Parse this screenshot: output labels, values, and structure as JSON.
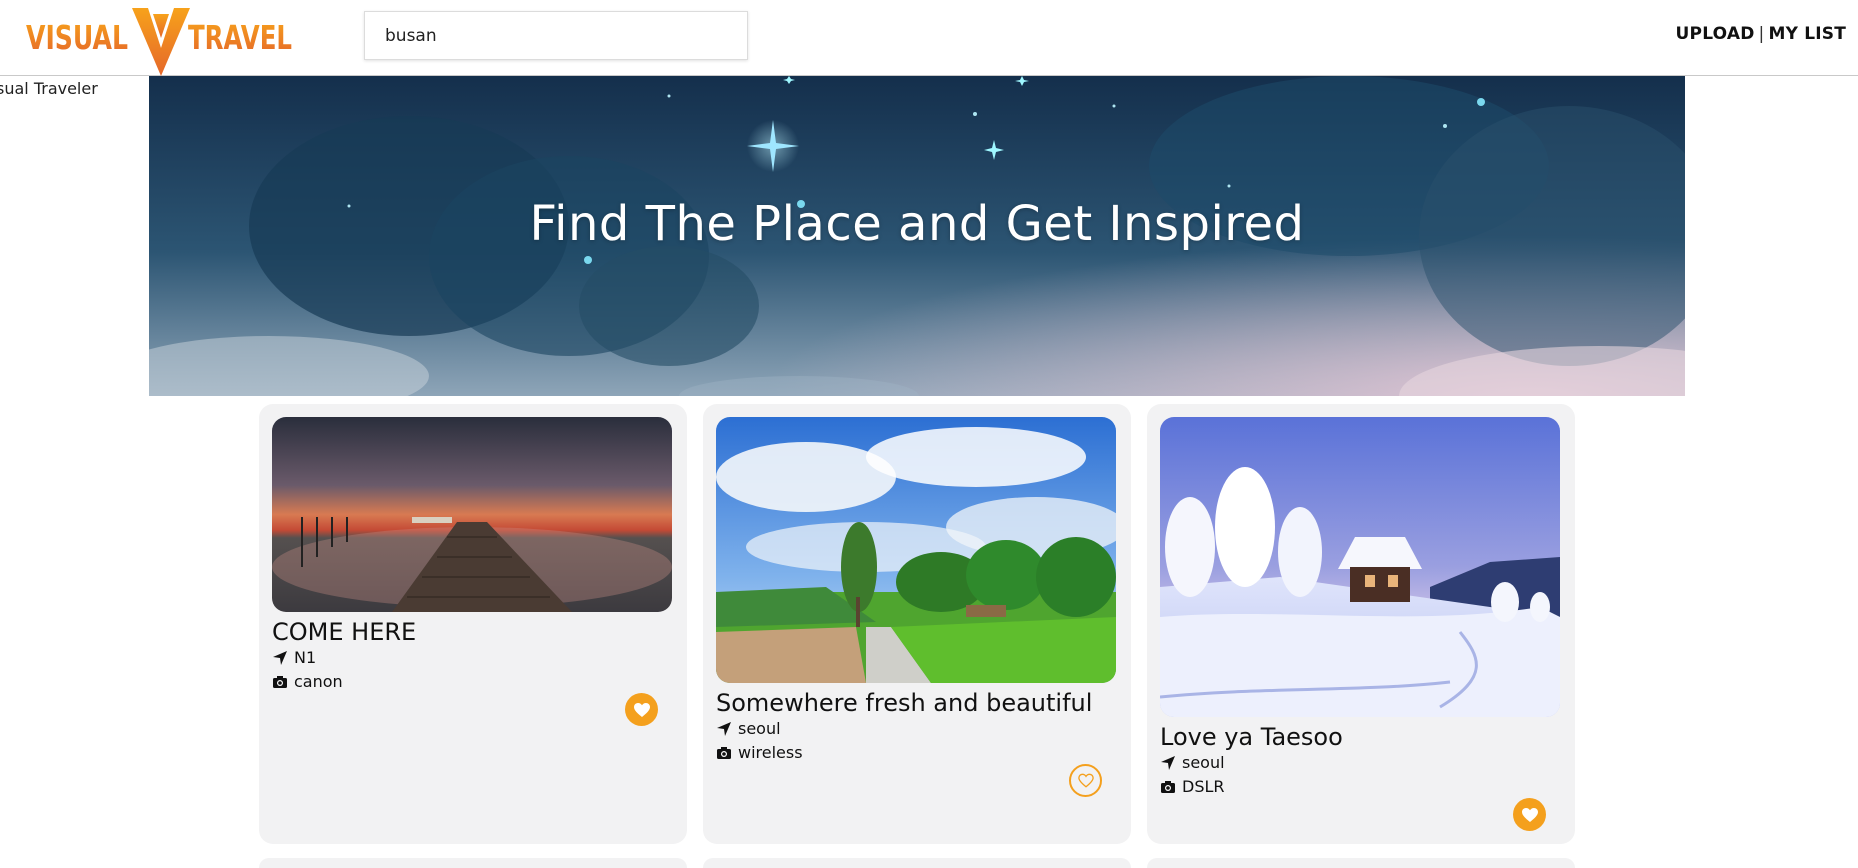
{
  "header": {
    "logo": {
      "left_text": "VISUAL",
      "right_text": "TRAVEL"
    },
    "search": {
      "value": "busan"
    },
    "nav": {
      "upload": "UPLOAD",
      "separator": "|",
      "my_list": "MY LIST"
    }
  },
  "site_name": "sual Traveler",
  "hero": {
    "title": "Find The Place and Get Inspired"
  },
  "colors": {
    "accent": "#f4a01d",
    "card_bg": "#f2f2f3"
  },
  "cards": [
    {
      "title": "COME HERE",
      "location": "N1",
      "camera": "canon",
      "liked": true,
      "photo": "pier-sunset"
    },
    {
      "title": "Somewhere fresh and beautiful",
      "location": "seoul",
      "camera": "wireless",
      "liked": false,
      "photo": "green-field-path"
    },
    {
      "title": "Love ya Taesoo",
      "location": "seoul",
      "camera": "DSLR",
      "liked": true,
      "photo": "snowy-cabin"
    }
  ],
  "icons": {
    "location": "location-arrow-icon",
    "camera": "camera-icon",
    "like": "heart-icon"
  }
}
